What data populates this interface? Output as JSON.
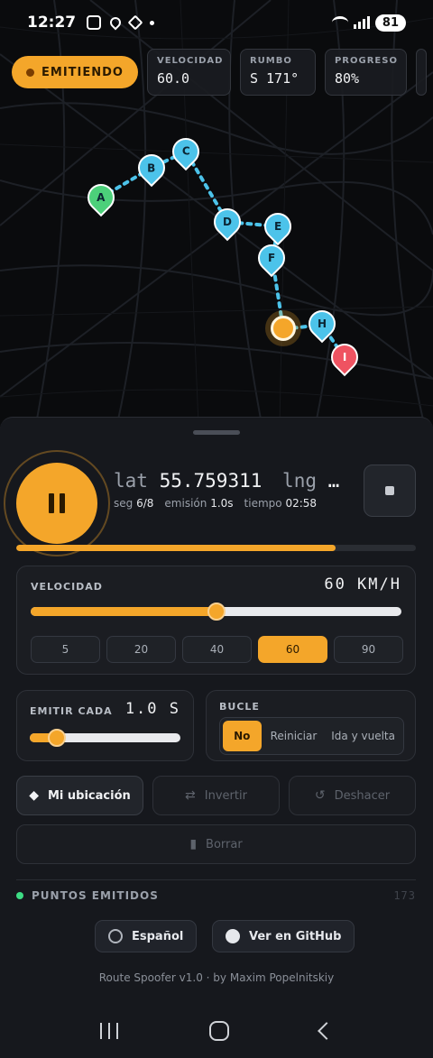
{
  "status_bar": {
    "time": "12:27",
    "battery": "81"
  },
  "chips": {
    "emitting": "EMITIENDO",
    "stats": [
      {
        "label": "VELOCIDAD",
        "value": "60.0"
      },
      {
        "label": "RUMBO",
        "value": "S 171°"
      },
      {
        "label": "PROGRESO",
        "value": "80%"
      }
    ]
  },
  "map": {
    "markers": [
      "A",
      "B",
      "C",
      "D",
      "E",
      "F",
      "H",
      "I"
    ]
  },
  "player": {
    "lat_label": "lat",
    "lat": "55.759311",
    "lng_label": "lng",
    "lng": "…",
    "seg_label": "seg",
    "seg": "6/8",
    "emission_label": "emisión",
    "emission": "1.0s",
    "time_label": "tiempo",
    "time": "02:58",
    "progress": 0.8
  },
  "speed": {
    "title": "VELOCIDAD",
    "value": "60 KM/H",
    "level": 0.5,
    "presets": [
      "5",
      "20",
      "40",
      "60",
      "90"
    ],
    "selected": "60"
  },
  "emit_every": {
    "title": "EMITIR CADA",
    "value": "1.0 S",
    "level": 0.18
  },
  "loop": {
    "title": "BUCLE",
    "options": [
      "No",
      "Reiniciar",
      "Ida y vuelta"
    ],
    "selected": "No"
  },
  "actions": {
    "my_location": "Mi ubicación",
    "invert": "Invertir",
    "undo": "Deshacer",
    "clear": "Borrar"
  },
  "emitted": {
    "label": "PUNTOS EMITIDOS",
    "count": "173"
  },
  "footer": {
    "language": "Español",
    "github": "Ver en GitHub",
    "credit": "Route Spoofer v1.0 · by Maxim Popelnitskiy"
  },
  "colors": {
    "accent": "#f4a62a",
    "route": "#4cc3ea",
    "start": "#4cd07a",
    "end": "#ef5361"
  }
}
